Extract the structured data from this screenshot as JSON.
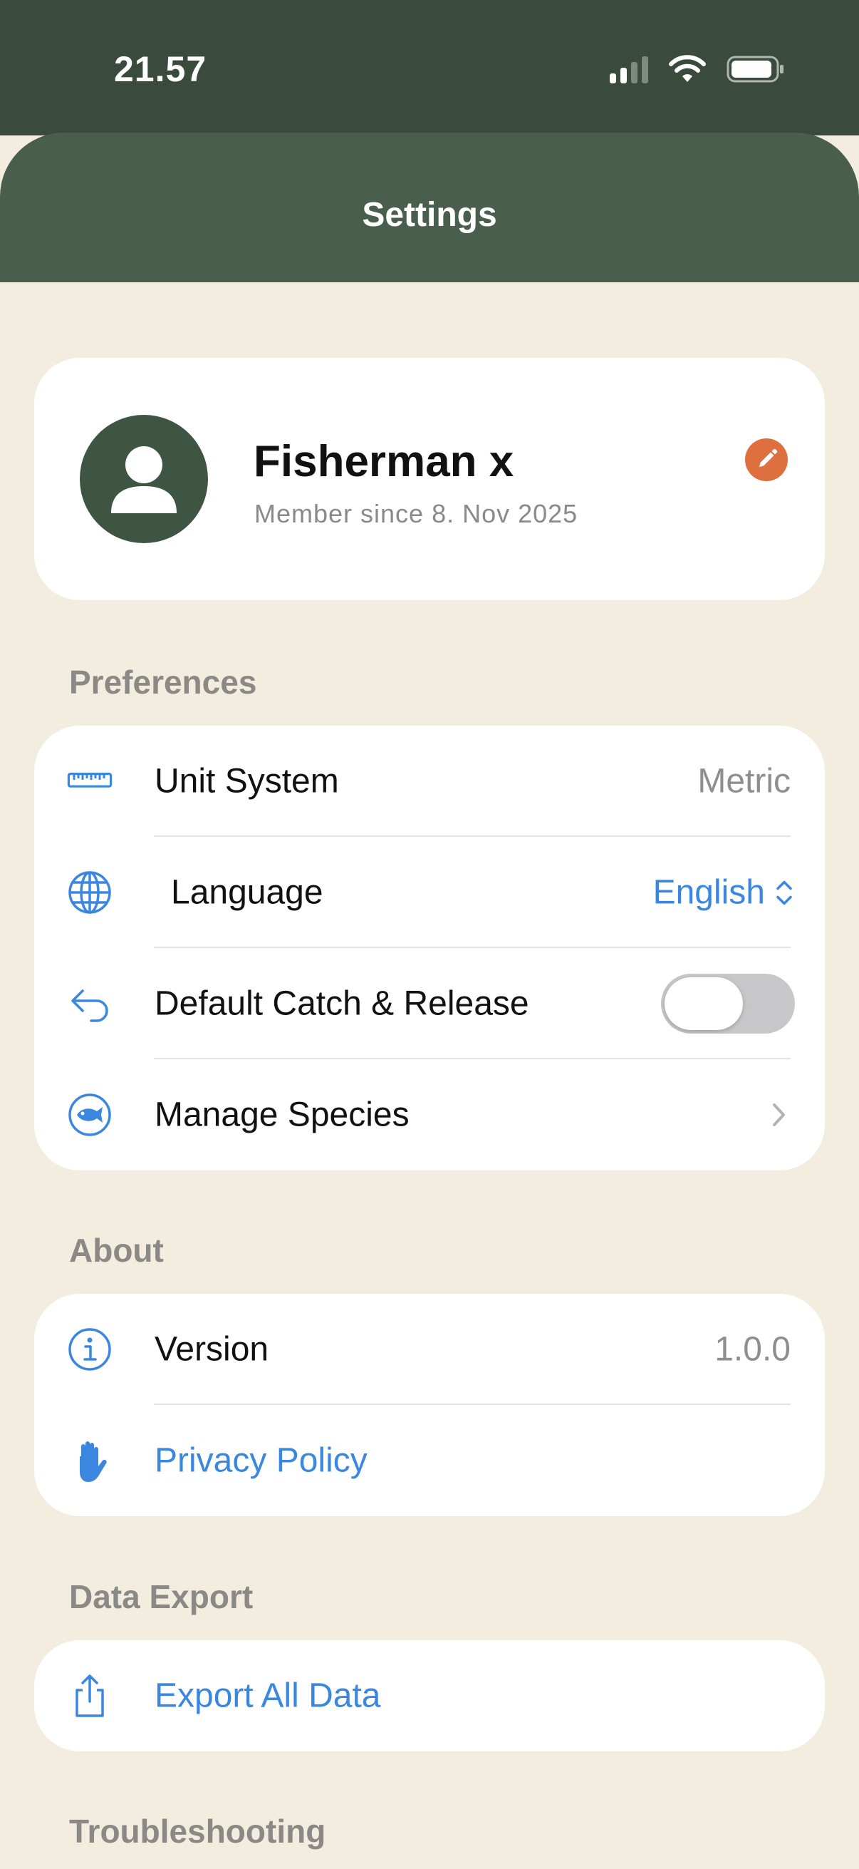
{
  "status_bar": {
    "time": "21.57"
  },
  "header": {
    "title": "Settings"
  },
  "profile": {
    "name": "Fisherman x",
    "member_since": "Member since 8. Nov 2025"
  },
  "preferences": {
    "title": "Preferences",
    "unit_system": {
      "label": "Unit System",
      "value": "Metric"
    },
    "language": {
      "label": "Language",
      "value": "English"
    },
    "catch_release": {
      "label": "Default Catch & Release",
      "enabled": false
    },
    "manage_species": {
      "label": "Manage Species"
    }
  },
  "about": {
    "title": "About",
    "version": {
      "label": "Version",
      "value": "1.0.0"
    },
    "privacy": {
      "label": "Privacy Policy"
    }
  },
  "data_export": {
    "title": "Data Export",
    "export": {
      "label": "Export All Data"
    }
  },
  "troubleshooting": {
    "title": "Troubleshooting"
  },
  "colors": {
    "status_bar": "#3a4a3d",
    "header": "#4a5e4e",
    "background": "#f3ede0",
    "accent_blue": "#3b87e0",
    "edit_orange": "#de6f3e",
    "avatar": "#3f5544"
  },
  "icons": {
    "unit_system": "ruler-icon",
    "language": "globe-icon",
    "catch_release": "return-arrow-icon",
    "manage_species": "fish-icon",
    "version": "info-icon",
    "privacy": "hand-icon",
    "export": "share-icon",
    "edit": "pencil-icon"
  }
}
